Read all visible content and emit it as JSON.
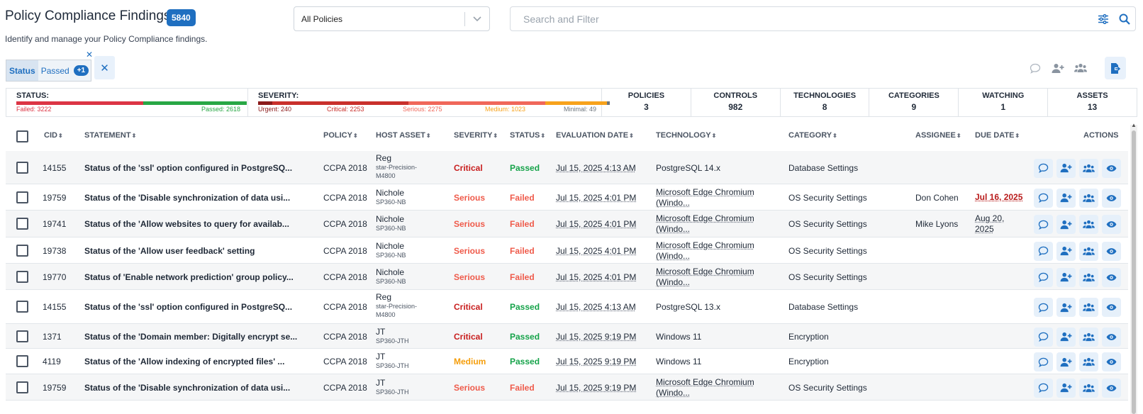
{
  "header": {
    "title": "Policy Compliance Findings",
    "count": "5840",
    "subtitle": "Identify and manage your Policy Compliance findings."
  },
  "policy_select": {
    "value": "All Policies"
  },
  "search": {
    "placeholder": "Search and Filter"
  },
  "filter_chip": {
    "key": "Status",
    "value": "Passed",
    "more": "+1"
  },
  "summary": {
    "status": {
      "label": "STATUS:",
      "failed": "Failed: 3222",
      "passed": "Passed: 2618",
      "failed_value": 3222,
      "passed_value": 2618
    },
    "severity": {
      "label": "SEVERITY:",
      "urgent": "Urgent: 240",
      "critical": "Critical: 2253",
      "serious": "Serious: 2275",
      "medium": "Medium: 1023",
      "minimal": "Minimal: 49",
      "values": [
        240,
        2253,
        2275,
        1023,
        49
      ]
    },
    "metrics": [
      {
        "label": "POLICIES",
        "value": "3"
      },
      {
        "label": "CONTROLS",
        "value": "982"
      },
      {
        "label": "TECHNOLOGIES",
        "value": "8"
      },
      {
        "label": "CATEGORIES",
        "value": "9"
      },
      {
        "label": "WATCHING",
        "value": "1"
      },
      {
        "label": "ASSETS",
        "value": "13"
      }
    ]
  },
  "colors": {
    "failed": "#dc3545",
    "passed": "#28a745",
    "urgent": "#8b1a1a",
    "critical": "#c9302c",
    "serious": "#f0675a",
    "medium": "#f7a21b",
    "minimal": "#6c757d",
    "accent": "#1f6fc0"
  },
  "table": {
    "headers": {
      "cid": "CID",
      "statement": "STATEMENT",
      "policy": "POLICY",
      "host": "HOST ASSET",
      "severity": "SEVERITY",
      "status": "STATUS",
      "date": "EVALUATION DATE",
      "technology": "TECHNOLOGY",
      "category": "CATEGORY",
      "assignee": "ASSIGNEE",
      "due": "DUE DATE",
      "actions": "ACTIONS"
    },
    "rows": [
      {
        "cid": "14155",
        "statement": "Status of the 'ssl' option configured in PostgreSQ...",
        "policy": "CCPA 2018",
        "host": "Reg",
        "host_sub": "star-Precision-M4800",
        "severity": "Critical",
        "status": "Passed",
        "date": "Jul 15, 2025 4:13 AM",
        "technology": "PostgreSQL 14.x",
        "category": "Database Settings",
        "assignee": "",
        "due": ""
      },
      {
        "cid": "19759",
        "statement": "Status of the 'Disable synchronization of data usi...",
        "policy": "CCPA 2018",
        "host": "Nichole",
        "host_sub": "SP360-NB",
        "severity": "Serious",
        "status": "Failed",
        "date": "Jul 15, 2025 4:01 PM",
        "technology": "Microsoft Edge Chromium (Windo...",
        "category": "OS Security Settings",
        "assignee": "Don Cohen",
        "due": "Jul 16, 2025"
      },
      {
        "cid": "19741",
        "statement": "Status of the 'Allow websites to query for availab...",
        "policy": "CCPA 2018",
        "host": "Nichole",
        "host_sub": "SP360-NB",
        "severity": "Serious",
        "status": "Failed",
        "date": "Jul 15, 2025 4:01 PM",
        "technology": "Microsoft Edge Chromium (Windo...",
        "category": "OS Security Settings",
        "assignee": "Mike Lyons",
        "due": "Aug 20, 2025"
      },
      {
        "cid": "19738",
        "statement": "Status of the 'Allow user feedback' setting",
        "policy": "CCPA 2018",
        "host": "Nichole",
        "host_sub": "SP360-NB",
        "severity": "Serious",
        "status": "Failed",
        "date": "Jul 15, 2025 4:01 PM",
        "technology": "Microsoft Edge Chromium (Windo...",
        "category": "OS Security Settings",
        "assignee": "",
        "due": ""
      },
      {
        "cid": "19770",
        "statement": "Status of 'Enable network prediction' group policy...",
        "policy": "CCPA 2018",
        "host": "Nichole",
        "host_sub": "SP360-NB",
        "severity": "Serious",
        "status": "Failed",
        "date": "Jul 15, 2025 4:01 PM",
        "technology": "Microsoft Edge Chromium (Windo...",
        "category": "OS Security Settings",
        "assignee": "",
        "due": ""
      },
      {
        "cid": "14155",
        "statement": "Status of the 'ssl' option configured in PostgreSQ...",
        "policy": "CCPA 2018",
        "host": "Reg",
        "host_sub": "star-Precision-M4800",
        "severity": "Critical",
        "status": "Passed",
        "date": "Jul 15, 2025 4:13 AM",
        "technology": "PostgreSQL 13.x",
        "category": "Database Settings",
        "assignee": "",
        "due": ""
      },
      {
        "cid": "1371",
        "statement": "Status of the 'Domain member: Digitally encrypt se...",
        "policy": "CCPA 2018",
        "host": "JT",
        "host_sub": "SP360-JTH",
        "severity": "Critical",
        "status": "Passed",
        "date": "Jul 15, 2025 9:19 PM",
        "technology": "Windows 11",
        "category": "Encryption",
        "assignee": "",
        "due": ""
      },
      {
        "cid": "4119",
        "statement": "Status of the 'Allow indexing of encrypted files' ...",
        "policy": "CCPA 2018",
        "host": "JT",
        "host_sub": "SP360-JTH",
        "severity": "Medium",
        "status": "Passed",
        "date": "Jul 15, 2025 9:19 PM",
        "technology": "Windows 11",
        "category": "Encryption",
        "assignee": "",
        "due": ""
      },
      {
        "cid": "19759",
        "statement": "Status of the 'Disable synchronization of data usi...",
        "policy": "CCPA 2018",
        "host": "JT",
        "host_sub": "SP360-JTH",
        "severity": "Serious",
        "status": "Failed",
        "date": "Jul 15, 2025 9:19 PM",
        "technology": "Microsoft Edge Chromium (Windo...",
        "category": "OS Security Settings",
        "assignee": "",
        "due": ""
      }
    ]
  }
}
